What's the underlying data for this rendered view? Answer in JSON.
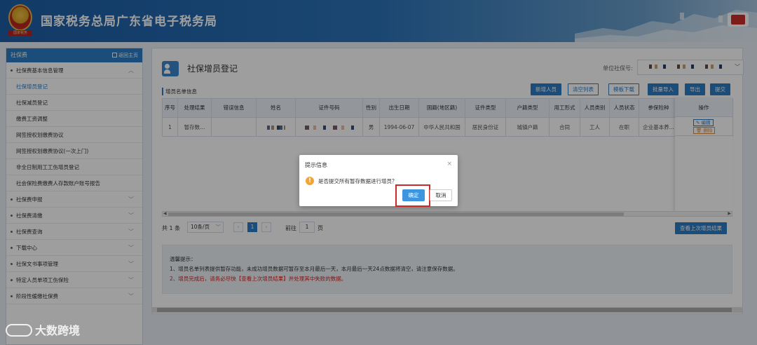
{
  "header": {
    "title": "国家税务总局广东省电子税务局",
    "emblem_label": "国家税务"
  },
  "sidebar": {
    "title": "社保费",
    "home_link": "返回主页",
    "items": [
      {
        "label": "社保费基本信息管理",
        "type": "group",
        "chev": "︿"
      },
      {
        "label": "社保增员登记",
        "type": "sub",
        "active": true
      },
      {
        "label": "社保减员登记",
        "type": "sub"
      },
      {
        "label": "缴费工资调整",
        "type": "sub"
      },
      {
        "label": "网签授权划缴费协议",
        "type": "sub"
      },
      {
        "label": "网签授权划缴费协议(一次上门)",
        "type": "sub"
      },
      {
        "label": "非全日制用工工伤增员登记",
        "type": "sub"
      },
      {
        "label": "社会保险费缴费人存款账户账号报告",
        "type": "sub"
      },
      {
        "label": "社保费申报",
        "type": "group",
        "chev": "﹀"
      },
      {
        "label": "社保费清缴",
        "type": "group",
        "chev": "﹀"
      },
      {
        "label": "社保费查询",
        "type": "group",
        "chev": "﹀"
      },
      {
        "label": "下载中心",
        "type": "group",
        "chev": "﹀"
      },
      {
        "label": "社保文书事项管理",
        "type": "group",
        "chev": "﹀"
      },
      {
        "label": "特定人员单项工伤保险",
        "type": "group",
        "chev": "﹀"
      },
      {
        "label": "阶段性缓缴社保费",
        "type": "group",
        "chev": "﹀"
      }
    ]
  },
  "main": {
    "title": "社保增员登记",
    "unit_label": "单位社保号:",
    "list_label": "增员名单信息",
    "buttons": {
      "add": "新增人员",
      "clear": "清空列表",
      "template": "模板下载",
      "import": "批量导入",
      "export": "导出",
      "submit": "提交",
      "view_last": "查看上次增员结果"
    },
    "table": {
      "headers": [
        "序号",
        "处理结果",
        "错误信息",
        "姓名",
        "证件号码",
        "性别",
        "出生日期",
        "国籍(地区籍)",
        "证件类型",
        "户籍类型",
        "用工形式",
        "人员类别",
        "人员状态",
        "参保险种",
        "操作"
      ],
      "row": {
        "seq": "1",
        "result": "暂存数...",
        "error": "",
        "gender": "男",
        "birth": "1994-06-07",
        "nationality": "中华人民共和国",
        "id_type": "居民身份证",
        "hukou": "城镇户籍",
        "employment": "合同",
        "category": "工人",
        "status": "在职",
        "insurance": "企业基本养..."
      },
      "edit": "编辑",
      "delete": "删除"
    },
    "pager": {
      "total": "共 1 条",
      "size": "10条/页",
      "current": "1",
      "goto": "前往",
      "goto_value": "1",
      "page": "页"
    },
    "notice": {
      "title": "温馨提示：",
      "line1": "1、增员名单列表提供暂存功能，未成功增员数据可暂存至本月最后一天，本月最后一天24点数据将清空，请注意保存数据。",
      "line2": "2、增员完成后，请务必尽快【查看上次增员结果】并处理其中失败的数据。"
    }
  },
  "dialog": {
    "title": "提示信息",
    "message": "是否提交所有暂存数据进行增员？",
    "ok": "确定",
    "cancel": "取消"
  },
  "watermark": "大数跨境",
  "colors": {
    "primary": "#2c7cc6",
    "warning": "#f2a536",
    "danger": "#c92a2a"
  }
}
